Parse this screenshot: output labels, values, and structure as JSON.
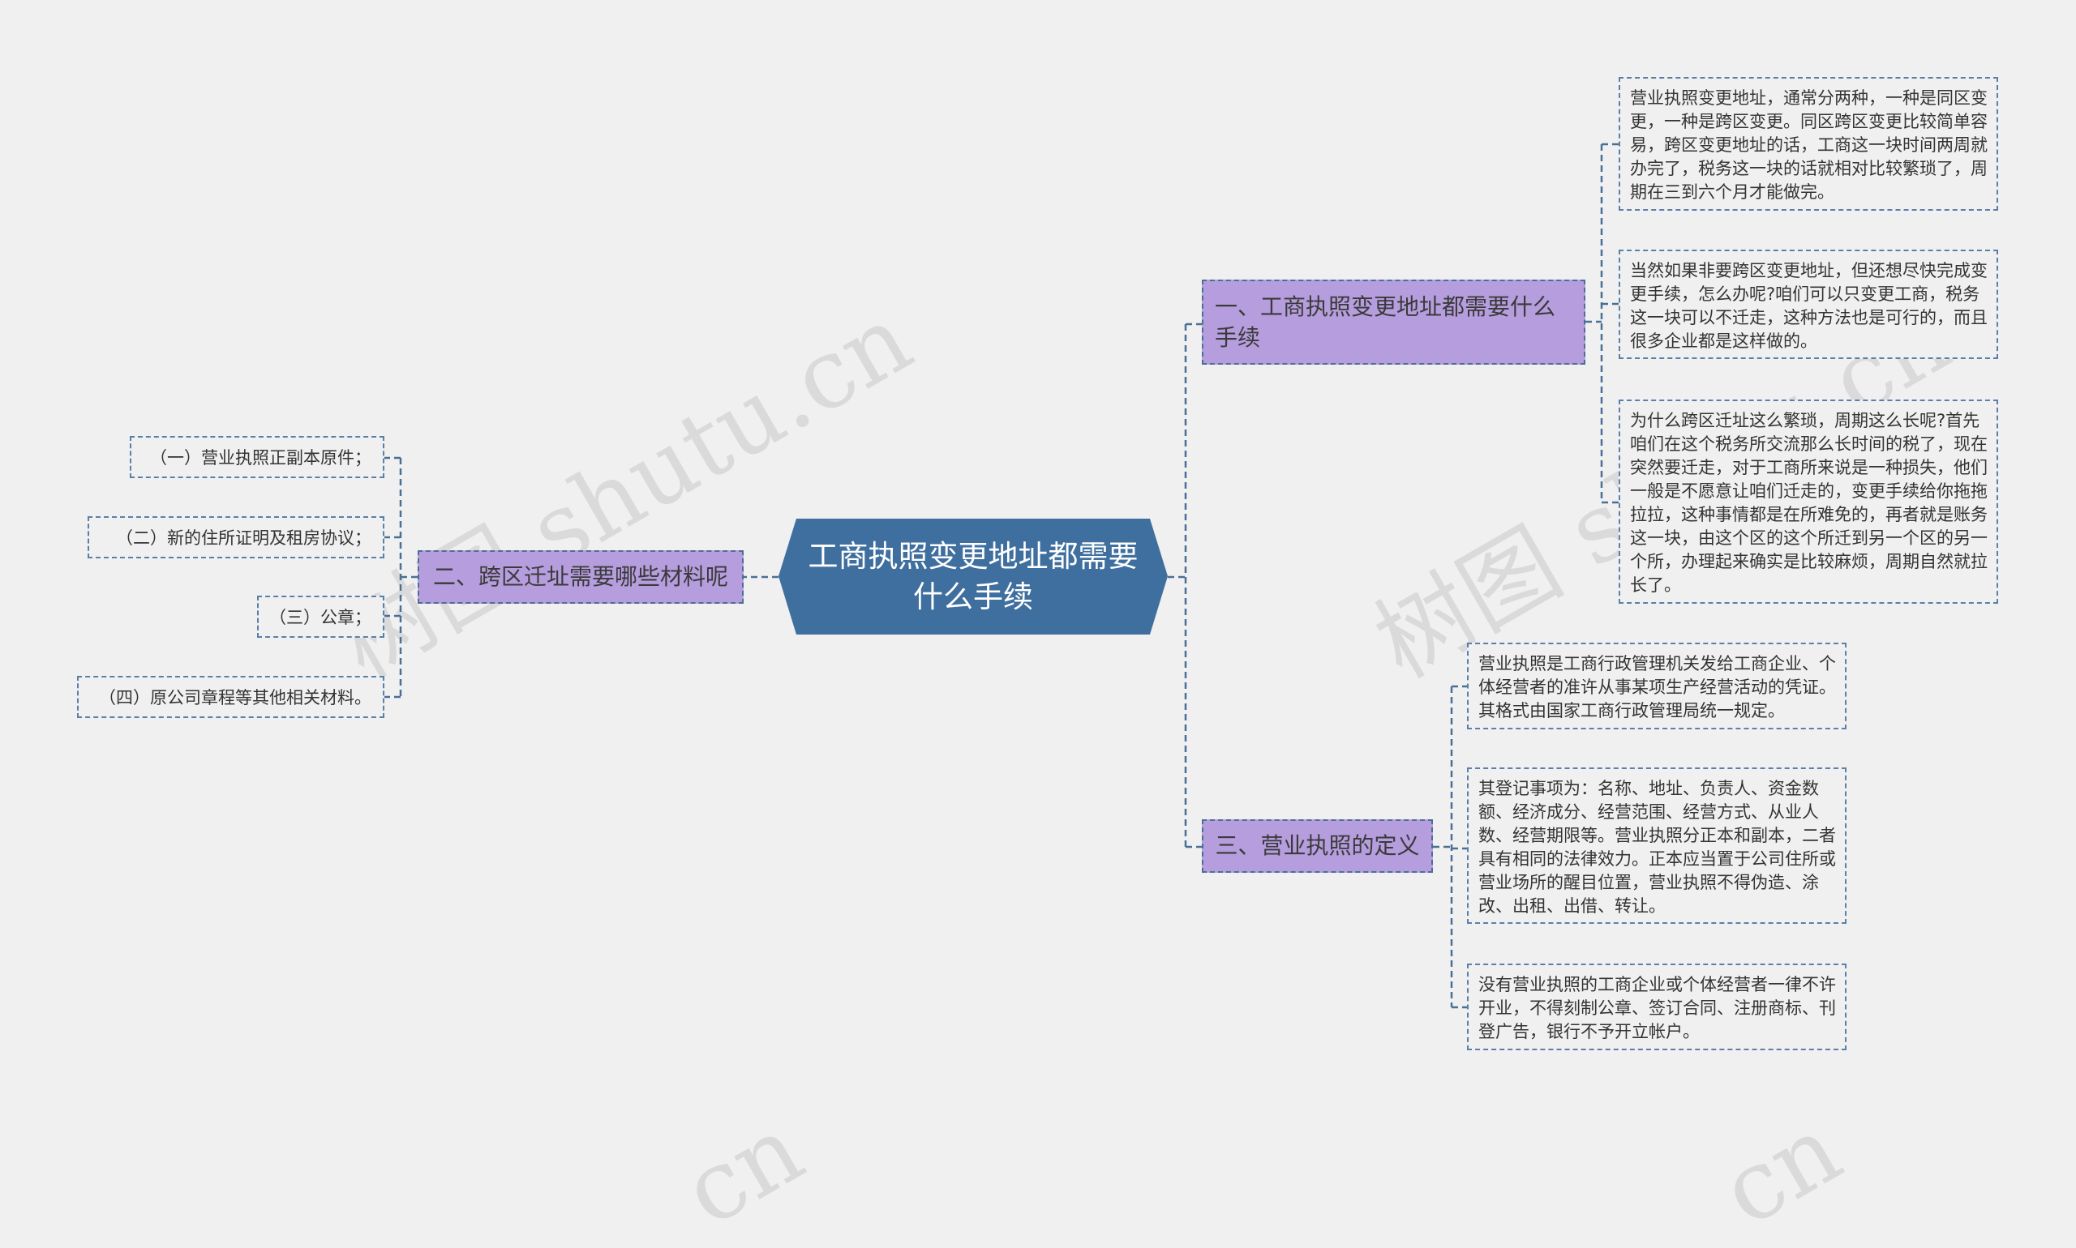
{
  "watermark": "树图 shutu.cn",
  "watermark_partial": "cn",
  "colors": {
    "root": "#3f6f9e",
    "branch": "#b69ddd",
    "line": "#4a6f95",
    "background": "#f0f0f0"
  },
  "root": {
    "label": "工商执照变更地址都需要什么手续"
  },
  "branches": [
    {
      "label": "一、工商执照变更地址都需要什么手续",
      "leaves": [
        "营业执照变更地址，通常分两种，一种是同区变更，一种是跨区变更。同区跨区变更比较简单容易，跨区变更地址的话，工商这一块时间两周就办完了，税务这一块的话就相对比较繁琐了，周期在三到六个月才能做完。",
        "当然如果非要跨区变更地址，但还想尽快完成变更手续，怎么办呢?咱们可以只变更工商，税务这一块可以不迁走，这种方法也是可行的，而且很多企业都是这样做的。",
        "为什么跨区迁址这么繁琐，周期这么长呢?首先咱们在这个税务所交流那么长时间的税了，现在突然要迁走，对于工商所来说是一种损失，他们一般是不愿意让咱们迁走的，变更手续给你拖拖拉拉，这种事情都是在所难免的，再者就是账务这一块，由这个区的这个所迁到另一个区的另一个所，办理起来确实是比较麻烦，周期自然就拉长了。"
      ]
    },
    {
      "label": "二、跨区迁址需要哪些材料呢",
      "leaves": [
        "（一）营业执照正副本原件；",
        "（二）新的住所证明及租房协议；",
        "（三）公章；",
        "（四）原公司章程等其他相关材料。"
      ]
    },
    {
      "label": "三、营业执照的定义",
      "leaves": [
        "营业执照是工商行政管理机关发给工商企业、个体经营者的准许从事某项生产经营活动的凭证。其格式由国家工商行政管理局统一规定。",
        "其登记事项为：名称、地址、负责人、资金数额、经济成分、经营范围、经营方式、从业人数、经营期限等。营业执照分正本和副本，二者具有相同的法律效力。正本应当置于公司住所或营业场所的醒目位置，营业执照不得伪造、涂改、出租、出借、转让。",
        "没有营业执照的工商企业或个体经营者一律不许开业，不得刻制公章、签订合同、注册商标、刊登广告，银行不予开立帐户。"
      ]
    }
  ]
}
